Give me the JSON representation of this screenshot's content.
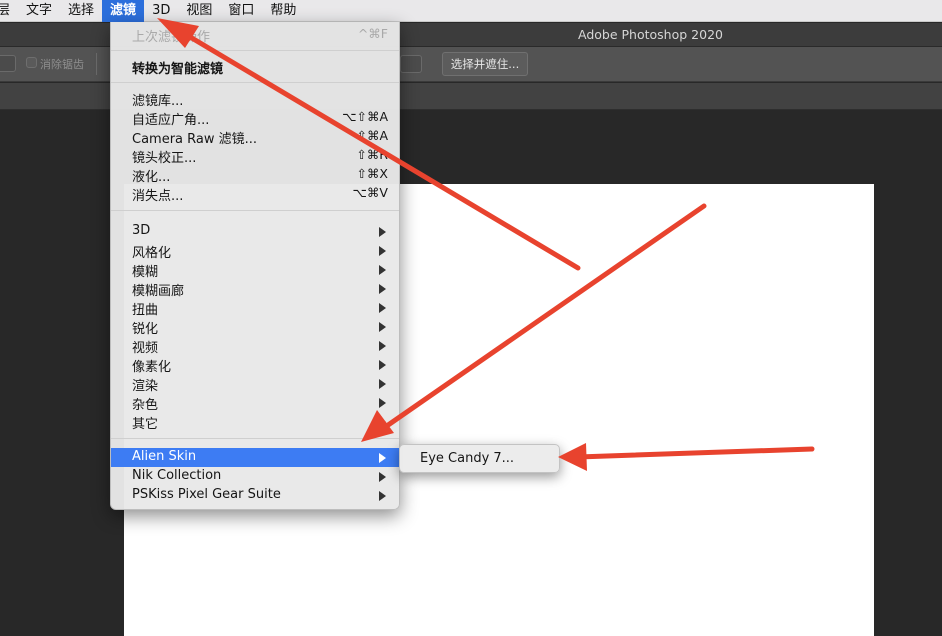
{
  "menubar": {
    "items": [
      "层",
      "文字",
      "选择",
      "滤镜",
      "3D",
      "视图",
      "窗口",
      "帮助"
    ]
  },
  "window": {
    "title": "Adobe Photoshop 2020"
  },
  "options_bar": {
    "antialias_label": "消除锯齿",
    "select_mask_button": "选择并遮住..."
  },
  "filter_menu": {
    "last_filter": {
      "label": "上次滤镜操作",
      "shortcut": "^⌘F"
    },
    "smart_filter": "转换为智能滤镜",
    "gallery": [
      {
        "label": "滤镜库...",
        "shortcut": ""
      },
      {
        "label": "自适应广角...",
        "shortcut": "⌥⇧⌘A"
      },
      {
        "label": "Camera Raw 滤镜...",
        "shortcut": "⇧⌘A"
      },
      {
        "label": "镜头校正...",
        "shortcut": "⇧⌘R"
      },
      {
        "label": "液化...",
        "shortcut": "⇧⌘X"
      },
      {
        "label": "消失点...",
        "shortcut": "⌥⌘V"
      }
    ],
    "groups": [
      "3D",
      "风格化",
      "模糊",
      "模糊画廊",
      "扭曲",
      "锐化",
      "视频",
      "像素化",
      "渲染",
      "杂色",
      "其它"
    ],
    "plugins": [
      "Alien Skin",
      "Nik Collection",
      "PSKiss Pixel Gear Suite"
    ]
  },
  "submenu": {
    "items": [
      "Eye Candy 7..."
    ]
  },
  "colors": {
    "highlight": "#3d7cf3",
    "menu_active": "#2c6fdc",
    "annotation_arrow": "#e8432e"
  }
}
